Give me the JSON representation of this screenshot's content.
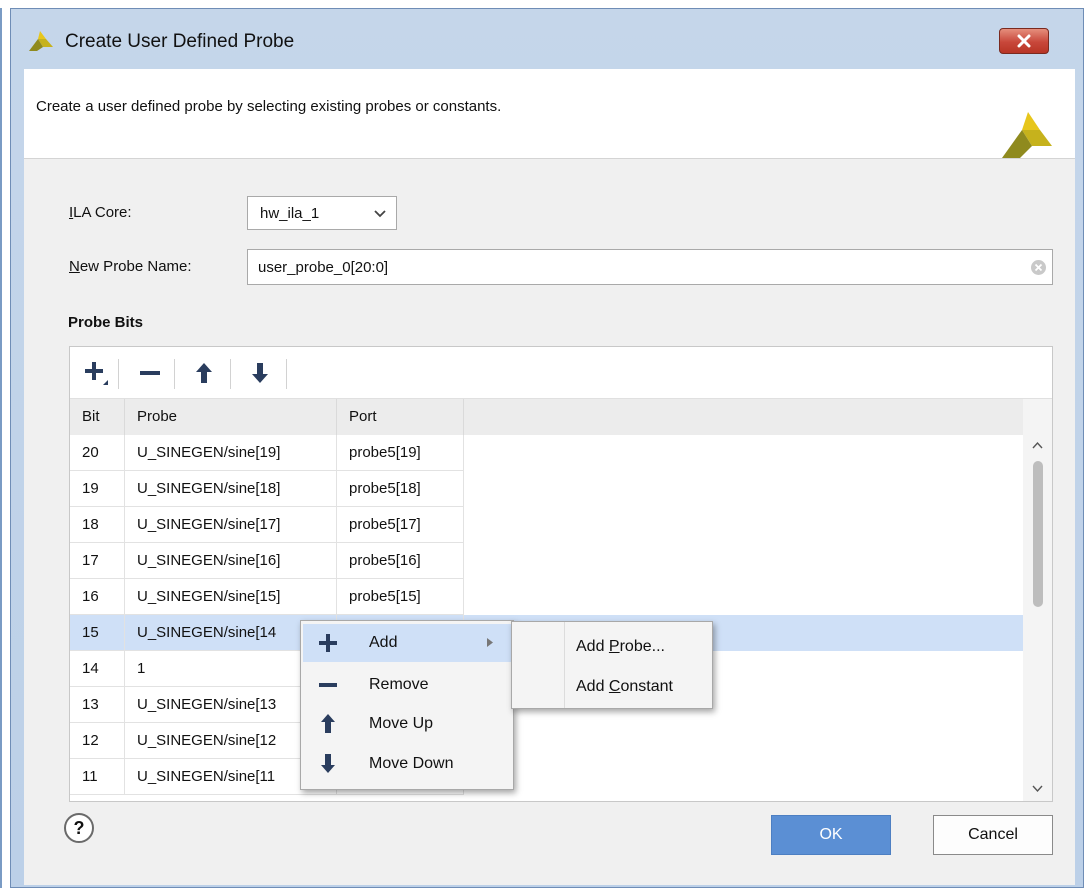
{
  "window": {
    "title": "Create User Defined Probe",
    "close_glyph": "✕",
    "logo_icon": "xilinx-logo-icon"
  },
  "header": {
    "description": "Create a user defined probe by selecting existing probes or constants."
  },
  "form": {
    "ila_core_label_key": "I",
    "ila_core_label_rest": "LA Core:",
    "ila_core_value": "hw_ila_1",
    "probe_name_label_key": "N",
    "probe_name_label_rest": "ew Probe Name:",
    "probe_name_value": "user_probe_0[20:0]"
  },
  "probe_bits": {
    "section_title": "Probe Bits",
    "toolbar_icons": [
      "plus-icon",
      "minus-icon",
      "arrow-up-icon",
      "arrow-down-icon"
    ],
    "columns": [
      "Bit",
      "Probe",
      "Port"
    ],
    "rows": [
      {
        "bit": "20",
        "probe": "U_SINEGEN/sine[19]",
        "port": "probe5[19]"
      },
      {
        "bit": "19",
        "probe": "U_SINEGEN/sine[18]",
        "port": "probe5[18]"
      },
      {
        "bit": "18",
        "probe": "U_SINEGEN/sine[17]",
        "port": "probe5[17]"
      },
      {
        "bit": "17",
        "probe": "U_SINEGEN/sine[16]",
        "port": "probe5[16]"
      },
      {
        "bit": "16",
        "probe": "U_SINEGEN/sine[15]",
        "port": "probe5[15]"
      },
      {
        "bit": "15",
        "probe": "U_SINEGEN/sine[14",
        "port": ""
      },
      {
        "bit": "14",
        "probe": "1",
        "port": ""
      },
      {
        "bit": "13",
        "probe": "U_SINEGEN/sine[13",
        "port": ""
      },
      {
        "bit": "12",
        "probe": "U_SINEGEN/sine[12",
        "port": ""
      },
      {
        "bit": "11",
        "probe": "U_SINEGEN/sine[11",
        "port": ""
      }
    ],
    "selected_bit": "15"
  },
  "context_menu": {
    "items": [
      {
        "label": "Add",
        "icon": "plus-icon",
        "has_submenu": true
      },
      {
        "label": "Remove",
        "icon": "minus-icon"
      },
      {
        "label": "Move Up",
        "icon": "arrow-up-icon"
      },
      {
        "label": "Move Down",
        "icon": "arrow-down-icon"
      }
    ],
    "submenu": [
      {
        "pre": "Add ",
        "key": "P",
        "post": "robe..."
      },
      {
        "pre": "Add ",
        "key": "C",
        "post": "onstant"
      }
    ]
  },
  "footer": {
    "help_label": "?",
    "ok_label": "OK",
    "cancel_label": "Cancel"
  },
  "colors": {
    "selection": "#cfe0f7",
    "primary_button": "#5b8fd4",
    "logo_yellow": "#e7c61b",
    "logo_olive": "#8f8a1e",
    "icon_navy": "#2a3d5e"
  }
}
